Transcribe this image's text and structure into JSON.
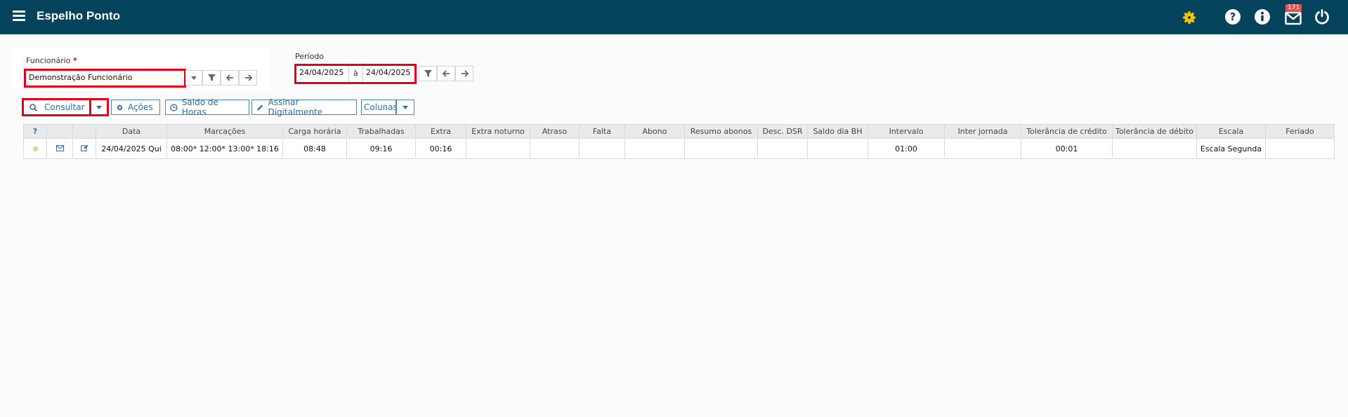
{
  "header": {
    "title": "Espelho Ponto",
    "notifications_count": "171",
    "icons": [
      "menu-icon",
      "gear-icon",
      "help-icon",
      "info-icon",
      "mail-icon",
      "power-icon"
    ],
    "bg_color": "#04435b",
    "gear_color": "#f2c500"
  },
  "filters": {
    "employee_label": "Funcionário",
    "employee_required": "*",
    "employee_value": "Demonstração Funcionário",
    "period_label": "Período",
    "period_start": "24/04/2025",
    "period_separator": "à",
    "period_end": "24/04/2025"
  },
  "toolbar": {
    "consultar": "Consultar",
    "acoes": "Ações",
    "saldo_horas": "Saldo de Horas",
    "assinar": "Assinar Digitalmente",
    "colunas": "Colunas"
  },
  "table": {
    "headers": [
      "?",
      "",
      "",
      "Data",
      "Marcações",
      "Carga horária",
      "Trabalhadas",
      "Extra",
      "Extra noturno",
      "Atraso",
      "Falta",
      "Abono",
      "Resumo abonos",
      "Desc. DSR",
      "Saldo dia BH",
      "Intervalo",
      "Inter jornada",
      "Tolerância de crédito",
      "Tolerância de débito",
      "Escala",
      "Feriado"
    ],
    "rows": [
      {
        "data": "24/04/2025 Qui",
        "marcacoes": "08:00* 12:00* 13:00* 18:16",
        "carga_horaria": "08:48",
        "trabalhadas": "09:16",
        "extra": "00:16",
        "extra_noturno": "",
        "atraso": "",
        "falta": "",
        "abono": "",
        "resumo_abonos": "",
        "desc_dsr": "",
        "saldo_dia_bh": "",
        "intervalo": "01:00",
        "inter_jornada": "",
        "tolerancia_credito": "00:01",
        "tolerancia_debito": "",
        "escala": "Escala Segunda",
        "feriado": ""
      }
    ]
  }
}
